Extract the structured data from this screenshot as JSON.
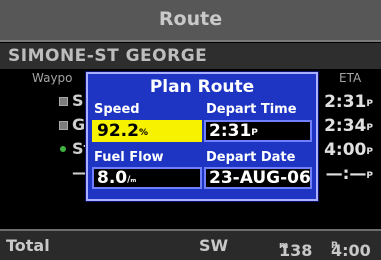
{
  "header": {
    "title": "Route"
  },
  "route": {
    "name": "SIMONE-ST GEORGE"
  },
  "columns": {
    "waypoint": "Waypo",
    "eta": "ETA"
  },
  "rows": [
    {
      "name": "SI",
      "eta": "2:31",
      "eta_unit": "P"
    },
    {
      "name": "GE",
      "eta": "2:34",
      "eta_unit": "P"
    },
    {
      "name": "St",
      "eta": "4:00",
      "eta_unit": "P"
    },
    {
      "name": "—",
      "eta": "—:—",
      "eta_unit": "P"
    }
  ],
  "footer": {
    "label": "Total",
    "direction": "SW",
    "distance": "138",
    "distance_unit": "m",
    "eta": "4:00",
    "eta_unit": "P"
  },
  "dialog": {
    "title": "Plan Route",
    "speed_label": "Speed",
    "speed_value": "92.2",
    "speed_unit": "%",
    "depart_time_label": "Depart Time",
    "depart_time_value": "2:31",
    "depart_time_unit": "P",
    "fuel_flow_label": "Fuel Flow",
    "fuel_flow_value": "8.0",
    "fuel_flow_unit": "/ₘ",
    "depart_date_label": "Depart Date",
    "depart_date_value": "23-AUG-06"
  },
  "colors": {
    "dialog_bg": "#1d35c2",
    "active_field": "#f7f200",
    "titlebar": "#575757"
  },
  "icons": [
    "waypoint-square-icon",
    "waypoint-square-icon",
    "waypoint-dot-icon"
  ]
}
